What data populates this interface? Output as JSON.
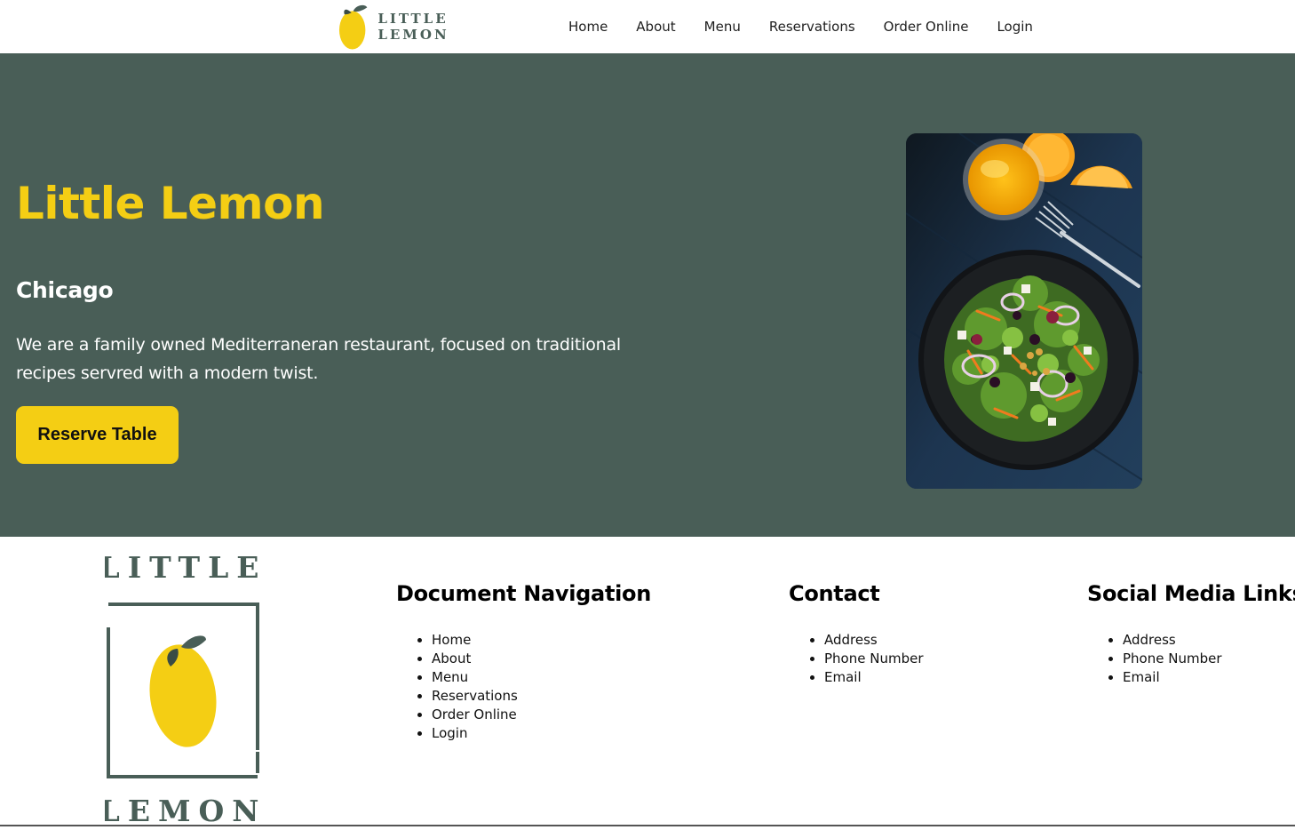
{
  "header": {
    "logo_text": "LITTLE LEMON",
    "nav": [
      "Home",
      "About",
      "Menu",
      "Reservations",
      "Order Online",
      "Login"
    ]
  },
  "hero": {
    "title": "Little Lemon",
    "city": "Chicago",
    "description": "We are a family owned Mediterraneran restaurant, focused on traditional recipes servred with a modern twist.",
    "button_label": "Reserve Table",
    "photo_icon": "salad-photo"
  },
  "footer": {
    "logo_top": "LITTLE",
    "logo_bottom": "LEMON",
    "columns": [
      {
        "heading": "Document Navigation",
        "items": [
          "Home",
          "About",
          "Menu",
          "Reservations",
          "Order Online",
          "Login"
        ]
      },
      {
        "heading": "Contact",
        "items": [
          "Address",
          "Phone Number",
          "Email"
        ]
      },
      {
        "heading": "Social Media Links",
        "items": [
          "Address",
          "Phone Number",
          "Email"
        ]
      }
    ]
  },
  "colors": {
    "primary_green": "#495e57",
    "primary_yellow": "#f4ce14",
    "text_dark": "#111111",
    "white": "#ffffff"
  }
}
